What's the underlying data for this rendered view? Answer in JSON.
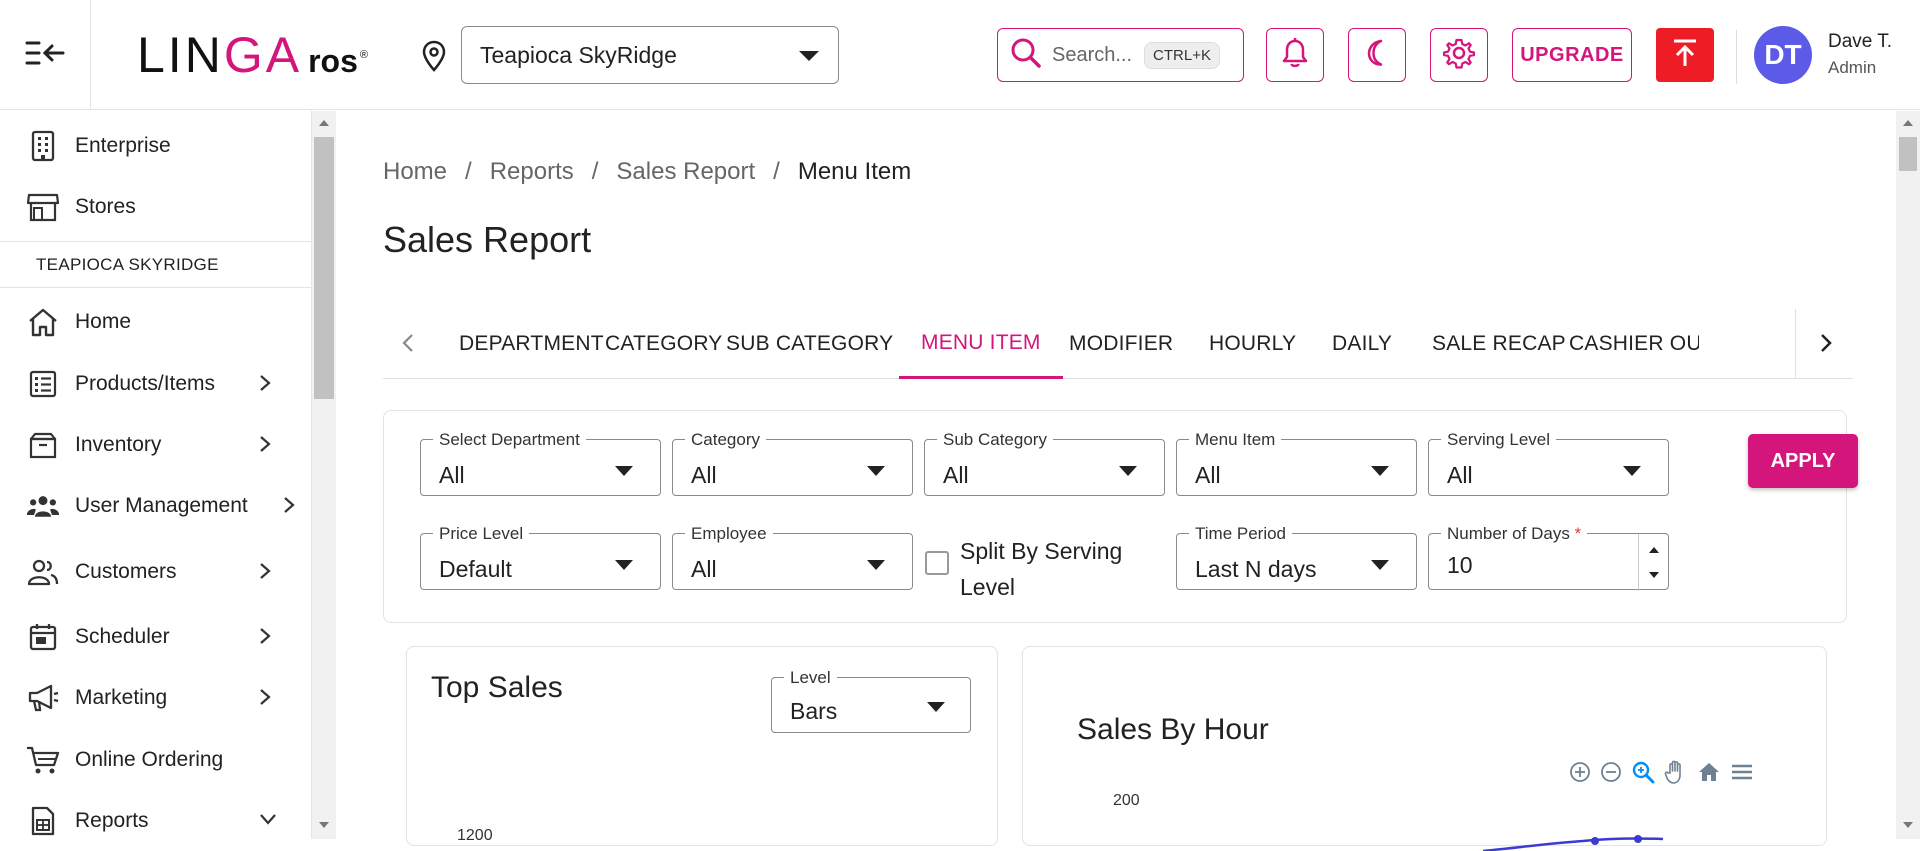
{
  "header": {
    "logo_main": "LIN",
    "logo_accent": "GA",
    "logo_suffix": "ros",
    "logo_reg": "®",
    "store": "Teapioca SkyRidge",
    "search_placeholder": "Search...",
    "search_shortcut": "CTRL+K",
    "upgrade_label": "UPGRADE",
    "user_initials": "DT",
    "user_name": "Dave T.",
    "user_role": "Admin",
    "accent_color": "#d4157b"
  },
  "sidebar": {
    "top_items": [
      {
        "label": "Enterprise",
        "icon": "building-icon"
      },
      {
        "label": "Stores",
        "icon": "store-icon"
      }
    ],
    "section_label": "TEAPIOCA SKYRIDGE",
    "items": [
      {
        "label": "Home",
        "icon": "home-icon"
      },
      {
        "label": "Products/Items",
        "icon": "list-icon"
      },
      {
        "label": "Inventory",
        "icon": "box-icon"
      },
      {
        "label": "User Management",
        "icon": "users-icon"
      },
      {
        "label": "Customers",
        "icon": "customers-icon"
      },
      {
        "label": "Scheduler",
        "icon": "calendar-icon"
      },
      {
        "label": "Marketing",
        "icon": "megaphone-icon"
      },
      {
        "label": "Online Ordering",
        "icon": "cart-icon"
      },
      {
        "label": "Reports",
        "icon": "report-icon"
      }
    ]
  },
  "breadcrumb": {
    "items": [
      "Home",
      "Reports",
      "Sales Report",
      "Menu Item"
    ],
    "separator": "/"
  },
  "page_title": "Sales Report",
  "tabs": [
    "DEPARTMENT",
    "CATEGORY",
    "SUB CATEGORY",
    "MENU ITEM",
    "MODIFIER",
    "HOURLY",
    "DAILY",
    "SALE RECAP",
    "CASHIER OUT"
  ],
  "active_tab": "MENU ITEM",
  "filters": {
    "department": {
      "label": "Select Department",
      "value": "All"
    },
    "category": {
      "label": "Category",
      "value": "All"
    },
    "sub_category": {
      "label": "Sub Category",
      "value": "All"
    },
    "menu_item": {
      "label": "Menu Item",
      "value": "All"
    },
    "serving_level": {
      "label": "Serving Level",
      "value": "All"
    },
    "price_level": {
      "label": "Price Level",
      "value": "Default"
    },
    "employee": {
      "label": "Employee",
      "value": "All"
    },
    "split_label": "Split By Serving Level",
    "time_period": {
      "label": "Time Period",
      "value": "Last N days"
    },
    "number_of_days": {
      "label": "Number of Days",
      "required_mark": "*",
      "value": "10"
    },
    "apply_label": "APPLY"
  },
  "top_sales": {
    "title": "Top Sales",
    "level_label": "Level",
    "level_value": "Bars",
    "y_tick_top": "1200"
  },
  "sales_by_hour": {
    "title": "Sales By Hour",
    "y_tick_top": "200"
  }
}
